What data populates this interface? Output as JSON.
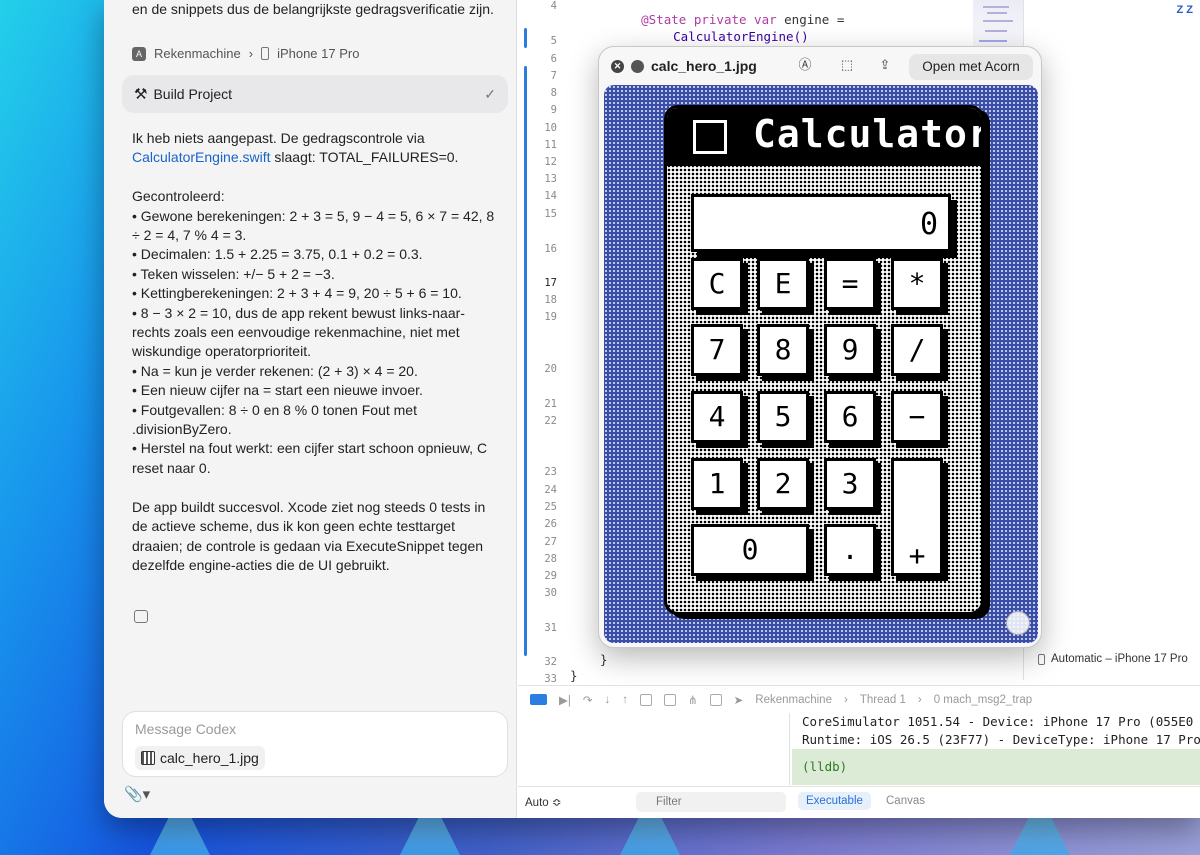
{
  "codex": {
    "intro_text": "en de snippets dus de belangrijkste gedragsverificatie zijn.",
    "breadcrumb": {
      "project": "Rekenmachine",
      "device": "iPhone 17 Pro"
    },
    "build": {
      "label": "Build Project",
      "status_icon": "checkmark-icon"
    },
    "message": {
      "p1_a": "Ik heb niets aangepast. De gedragscontrole via",
      "p1_link": "CalculatorEngine.swift",
      "p1_b": " slaagt: TOTAL_FAILURES=0.",
      "checked_title": "Gecontroleerd:",
      "items": [
        "• Gewone berekeningen: 2 + 3 = 5, 9 − 4 = 5, 6 × 7 = 42, 8 ÷ 2 = 4, 7 % 4 = 3.",
        "• Decimalen: 1.5 + 2.25 = 3.75, 0.1 + 0.2 = 0.3.",
        "• Teken wisselen: +/− 5 + 2 = −3.",
        "• Kettingberekeningen: 2 + 3 + 4 = 9, 20 ÷ 5 + 6 = 10.",
        "• 8 − 3 × 2 = 10, dus de app rekent bewust links-naar-rechts zoals een eenvoudige rekenmachine, niet met wiskundige operatorprioriteit.",
        "• Na = kun je verder rekenen: (2 + 3) × 4 = 20.",
        "• Een nieuw cijfer na = start een nieuwe invoer.",
        "• Foutgevallen: 8 ÷ 0 en 8 % 0 tonen Fout met .divisionByZero.",
        "• Herstel na fout werkt: een cijfer start schoon opnieuw, C reset naar 0."
      ],
      "p3": "De app buildt succesvol. Xcode ziet nog steeds 0 tests in de actieve scheme, dus ik kon geen echte testtarget draaien; de controle is gedaan via ExecuteSnippet tegen dezelfde engine-acties die de UI gebruikt."
    },
    "composer": {
      "placeholder": "Message Codex",
      "attachment": "calc_hero_1.jpg"
    }
  },
  "editor": {
    "line_numbers": [
      "4",
      "5",
      "6",
      "7",
      "8",
      "9",
      "10",
      "11",
      "12",
      "13",
      "14",
      "15",
      "16",
      "17",
      "18",
      "19",
      "20",
      "21",
      "22",
      "23",
      "24",
      "25",
      "26",
      "27",
      "28",
      "29",
      "30",
      "31",
      "32",
      "33"
    ],
    "current_line": "17",
    "code_line4_kw": "@State private var",
    "code_line4_rest": " engine =",
    "code_line5": "CalculatorEngine()",
    "code_line32": "}",
    "code_line33": "}",
    "right_panel_text": "Z\nZ",
    "device_selector": "Automatic – iPhone 17 Pro"
  },
  "debug_bar": {
    "scheme": "Rekenmachine",
    "thread": "Thread 1",
    "frame": "0 mach_msg2_trap"
  },
  "console": {
    "lines": [
      "CoreSimulator 1051.54 - Device: iPhone 17 Pro (055E0",
      "Runtime: iOS 26.5 (23F77) - DeviceType: iPhone 17 Pro"
    ],
    "prompt": "(lldb)"
  },
  "bottom_bar": {
    "auto": "Auto ≎",
    "filter_placeholder": "Filter",
    "executable": "Executable",
    "canvas": "Canvas"
  },
  "quicklook": {
    "filename": "calc_hero_1.jpg",
    "open_button": "Open met Acorn",
    "calculator": {
      "title": "Calculator",
      "display": "0",
      "keys": [
        "C",
        "E",
        "=",
        "*",
        "7",
        "8",
        "9",
        "/",
        "4",
        "5",
        "6",
        "−",
        "1",
        "2",
        "3",
        "+",
        "0",
        "."
      ]
    }
  }
}
